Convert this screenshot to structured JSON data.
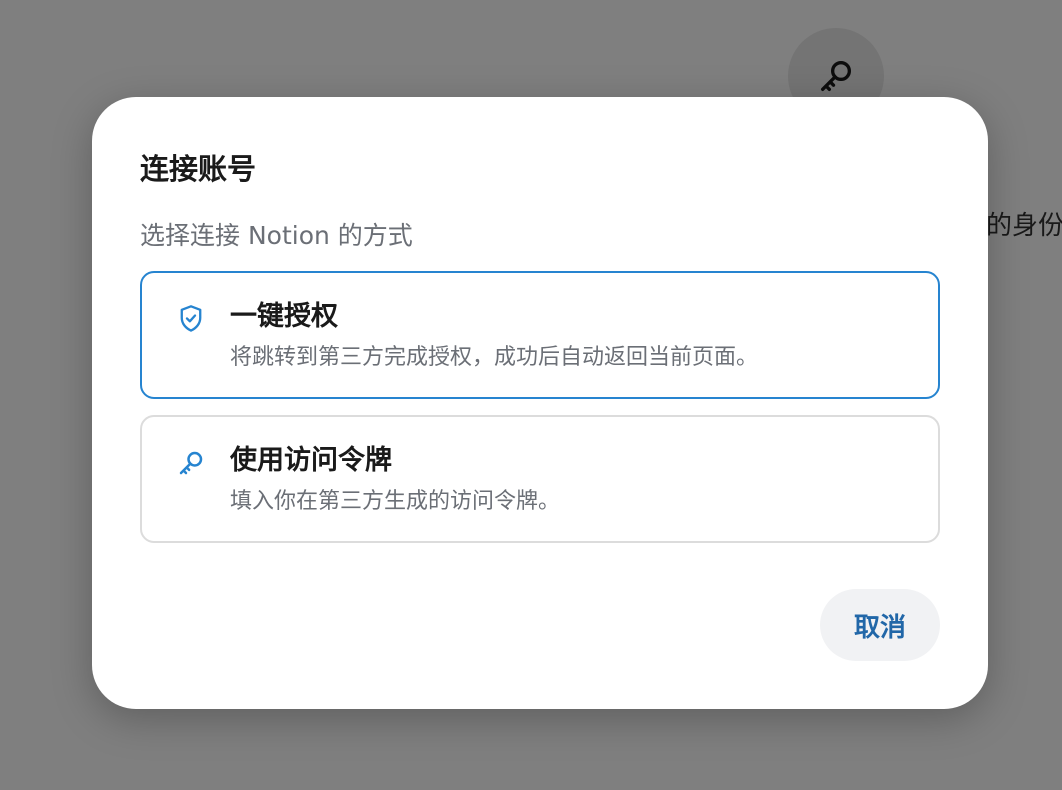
{
  "background": {
    "partial_text": "你的身份",
    "icon": "key-icon"
  },
  "dialog": {
    "title": "连接账号",
    "subtitle": "选择连接 Notion 的方式",
    "options": [
      {
        "title": "一键授权",
        "description": "将跳转到第三方完成授权，成功后自动返回当前页面。",
        "icon": "shield-check-icon",
        "selected": true
      },
      {
        "title": "使用访问令牌",
        "description": "填入你在第三方生成的访问令牌。",
        "icon": "key-icon",
        "selected": false
      }
    ],
    "cancel_label": "取消"
  },
  "colors": {
    "accent": "#2684d0",
    "cancel_text": "#2167a8",
    "overlay": "rgba(0,0,0,0.5)"
  }
}
